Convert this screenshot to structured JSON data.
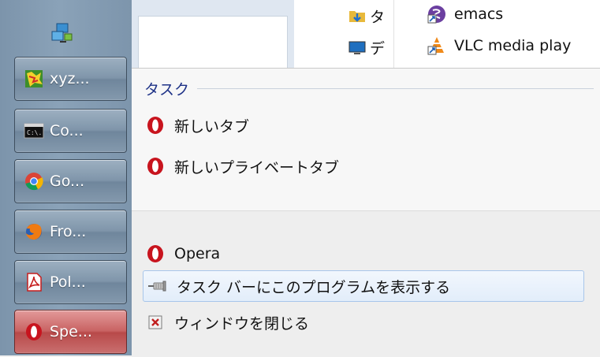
{
  "taskbar": {
    "items": [
      {
        "label": "xyz...",
        "icon": "xyz-app-icon"
      },
      {
        "label": "Co...",
        "icon": "command-prompt-icon"
      },
      {
        "label": "Go...",
        "icon": "chrome-icon"
      },
      {
        "label": "Fro...",
        "icon": "firefox-icon"
      },
      {
        "label": "Pol...",
        "icon": "pdf-icon"
      },
      {
        "label": "Spe...",
        "icon": "opera-icon"
      }
    ]
  },
  "explorer": {
    "items": [
      {
        "label": "タ",
        "icon": "folder-download-icon"
      },
      {
        "label": "デ",
        "icon": "desktop-icon"
      },
      {
        "label": "emacs",
        "icon": "emacs-shortcut-icon"
      },
      {
        "label": "VLC media play",
        "icon": "vlc-shortcut-icon"
      }
    ]
  },
  "jumplist": {
    "section_title": "タスク",
    "tasks": [
      {
        "label": "新しいタブ",
        "icon": "opera-icon"
      },
      {
        "label": "新しいプライベートタブ",
        "icon": "opera-icon"
      }
    ],
    "app": {
      "label": "Opera",
      "icon": "opera-icon"
    },
    "pin": {
      "label": "タスク バーにこのプログラムを表示する",
      "icon": "pin-icon"
    },
    "close": {
      "label": "ウィンドウを閉じる",
      "icon": "close-window-icon"
    }
  },
  "colors": {
    "section_title": "#1e3287",
    "opera_red": "#c8141e",
    "taskbar": "#8aa2b8",
    "active_button": "#c96363"
  }
}
